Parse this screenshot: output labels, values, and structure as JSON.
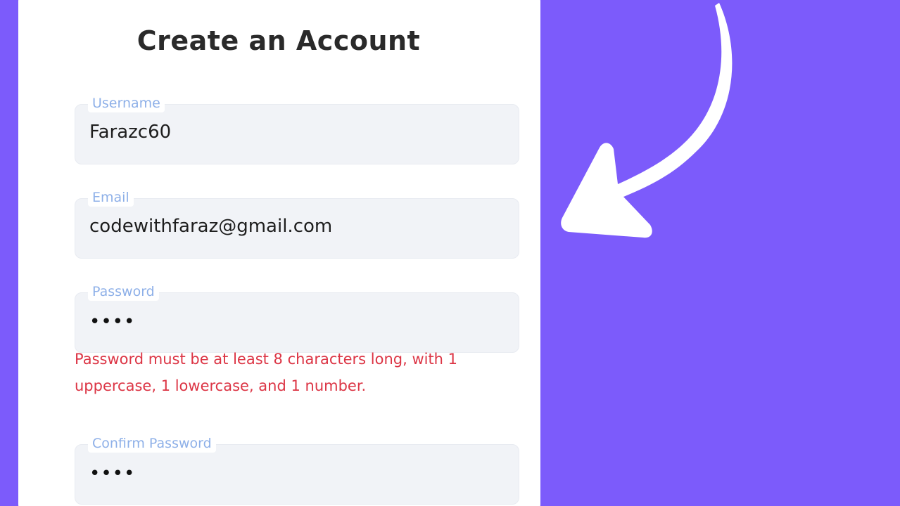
{
  "form": {
    "title": "Create an Account",
    "fields": {
      "username": {
        "label": "Username",
        "value": "Farazc60"
      },
      "email": {
        "label": "Email",
        "value": "codewithfaraz@gmail.com"
      },
      "password": {
        "label": "Password",
        "value": "••••"
      },
      "confirm_password": {
        "label": "Confirm Password",
        "value": "••••"
      }
    },
    "password_error": "Password must be at least 8 characters long, with 1 uppercase, 1 lowercase, and 1 number."
  },
  "decorations": {
    "arrow_icon": "curved-arrow-icon",
    "background_color": "#7c5bfb",
    "error_color": "#dc3545"
  }
}
